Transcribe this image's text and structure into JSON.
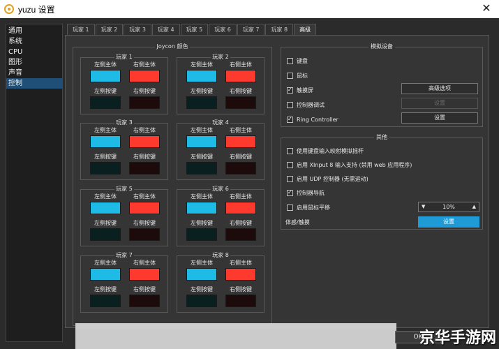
{
  "window": {
    "title": "yuzu 设置"
  },
  "sidebar": {
    "items": [
      "通用",
      "系统",
      "CPU",
      "图形",
      "声音",
      "控制"
    ],
    "active": "控制"
  },
  "tabs": [
    "玩家 1",
    "玩家 2",
    "玩家 3",
    "玩家 4",
    "玩家 5",
    "玩家 6",
    "玩家 7",
    "玩家 8",
    "高级"
  ],
  "active_tab": "高级",
  "joycon": {
    "title": "Joycon 颜色",
    "players": [
      "玩家 1",
      "玩家 2",
      "玩家 3",
      "玩家 4",
      "玩家 5",
      "玩家 6",
      "玩家 7",
      "玩家 8"
    ],
    "labels": {
      "left_body": "左侧主体",
      "right_body": "右侧主体",
      "left_buttons": "左侧按键",
      "right_buttons": "右侧按键"
    },
    "colors": {
      "left_body": "#1ebbe6",
      "right_body": "#fd3a2d",
      "left_buttons": "#0a1f1f",
      "right_buttons": "#1d0a0a"
    }
  },
  "emulated": {
    "title": "模拟设备",
    "keyboard": "键盘",
    "mouse": "鼠标",
    "touchscreen": "触摸屏",
    "debug_controller": "控制器调试",
    "ring_controller": "Ring Controller",
    "advanced_button": "高级选项",
    "configure_disabled": "设置",
    "configure_ring": "设置"
  },
  "other": {
    "title": "其他",
    "keyboard_as_stick": "使用键盘输入映射模拟摇杆",
    "xinput8": "启用 XInput 8 输入支持 (禁用 web 应用程序)",
    "udp": "启用 UDP 控制器 (无需运动)",
    "controller_nav": "控制器导航",
    "mouse_pan": "启用鼠标平移",
    "mouse_pan_value": "10%",
    "motion_touch": "体感/触摸",
    "motion_touch_button": "设置"
  },
  "bottom": {
    "ok": "OK"
  },
  "watermark": "京华手游网"
}
